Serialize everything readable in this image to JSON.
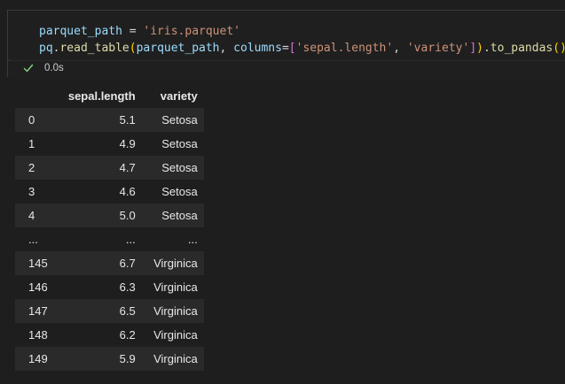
{
  "code_cell": {
    "line1": {
      "var": "parquet_path",
      "op": " = ",
      "str": "'iris.parquet'"
    },
    "line2": {
      "obj": "pq",
      "dot1": ".",
      "fn1": "read_table",
      "open1": "(",
      "arg1": "parquet_path",
      "comma1": ", ",
      "kw": "columns",
      "eq": "=",
      "open2": "[",
      "str1": "'sepal.length'",
      "comma2": ", ",
      "str2": "'variety'",
      "close2": "]",
      "close1": ")",
      "dot2": ".",
      "fn2": "to_pandas",
      "open3": "(",
      "close3": ")"
    }
  },
  "status": {
    "icon": "check-icon",
    "time": "0.0s",
    "check_color": "#89d185"
  },
  "table": {
    "columns": [
      "",
      "sepal.length",
      "variety"
    ],
    "rows": [
      {
        "index": "0",
        "sepal_length": "5.1",
        "variety": "Setosa"
      },
      {
        "index": "1",
        "sepal_length": "4.9",
        "variety": "Setosa"
      },
      {
        "index": "2",
        "sepal_length": "4.7",
        "variety": "Setosa"
      },
      {
        "index": "3",
        "sepal_length": "4.6",
        "variety": "Setosa"
      },
      {
        "index": "4",
        "sepal_length": "5.0",
        "variety": "Setosa"
      },
      {
        "index": "...",
        "sepal_length": "...",
        "variety": "..."
      },
      {
        "index": "145",
        "sepal_length": "6.7",
        "variety": "Virginica"
      },
      {
        "index": "146",
        "sepal_length": "6.3",
        "variety": "Virginica"
      },
      {
        "index": "147",
        "sepal_length": "6.5",
        "variety": "Virginica"
      },
      {
        "index": "148",
        "sepal_length": "6.2",
        "variety": "Virginica"
      },
      {
        "index": "149",
        "sepal_length": "5.9",
        "variety": "Virginica"
      }
    ]
  }
}
